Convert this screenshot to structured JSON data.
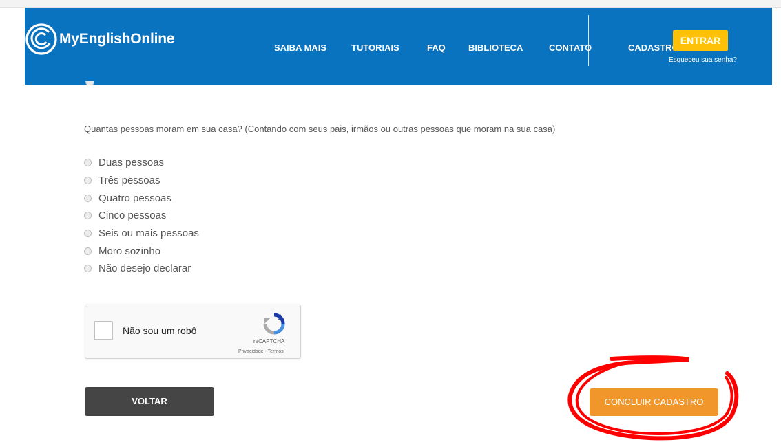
{
  "header": {
    "logo_text": "MyEnglishOnline",
    "nav": [
      "SAIBA MAIS",
      "TUTORIAIS",
      "FAQ",
      "BIBLIOTECA",
      "CONTATO"
    ],
    "cadastro_label": "CADASTRO",
    "entrar_label": "ENTRAR",
    "forgot_label": "Esqueceu sua senha?",
    "brand_color": "#0a73c0",
    "accent_color": "#ffc107"
  },
  "form": {
    "question": "Quantas pessoas moram em sua casa? (Contando com seus pais, irmãos ou outras pessoas que moram na sua casa)",
    "options": [
      "Duas pessoas",
      "Três pessoas",
      "Quatro pessoas",
      "Cinco pessoas",
      "Seis ou mais pessoas",
      "Moro sozinho",
      "Não desejo declarar"
    ]
  },
  "captcha": {
    "label": "Não sou um robô",
    "brand": "reCAPTCHA",
    "legal": "Privacidade - Termos"
  },
  "actions": {
    "back_label": "VOLTAR",
    "submit_label": "CONCLUIR CADASTRO",
    "submit_color": "#f0962a",
    "annotation_color": "#ff0000"
  }
}
